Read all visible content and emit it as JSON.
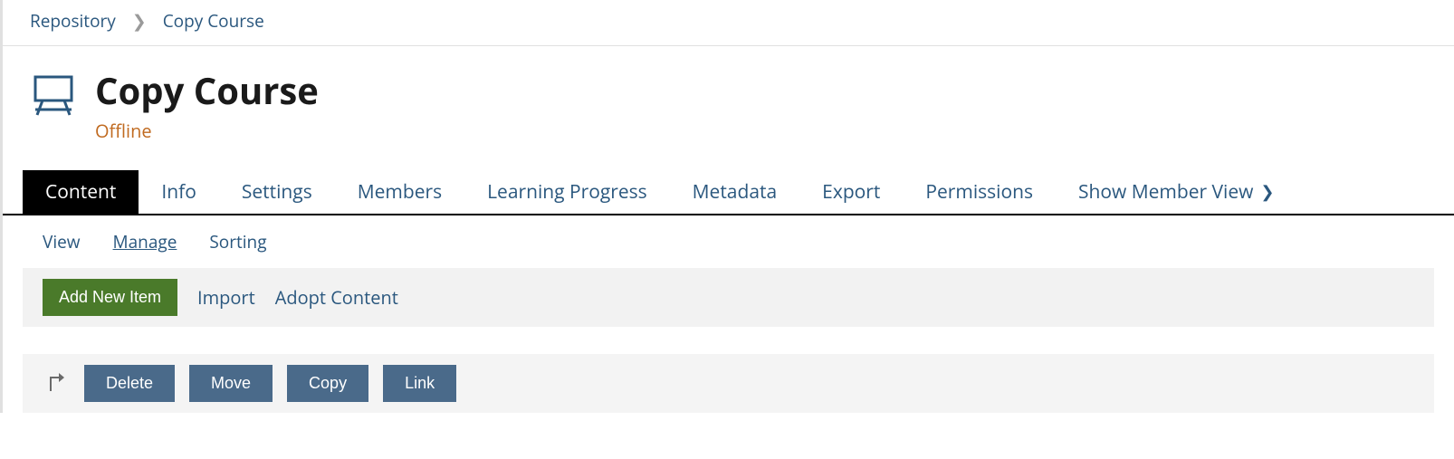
{
  "breadcrumb": {
    "root": "Repository",
    "current": "Copy Course"
  },
  "header": {
    "title": "Copy Course",
    "status": "Offline"
  },
  "tabs": [
    {
      "label": "Content",
      "active": true
    },
    {
      "label": "Info"
    },
    {
      "label": "Settings"
    },
    {
      "label": "Members"
    },
    {
      "label": "Learning Progress"
    },
    {
      "label": "Metadata"
    },
    {
      "label": "Export"
    },
    {
      "label": "Permissions"
    },
    {
      "label": "Show Member View",
      "hasArrow": true
    }
  ],
  "subtabs": [
    {
      "label": "View"
    },
    {
      "label": "Manage",
      "active": true
    },
    {
      "label": "Sorting"
    }
  ],
  "toolbar": {
    "primary": "Add New Item",
    "links": [
      "Import",
      "Adopt Content"
    ]
  },
  "actions": {
    "buttons": [
      "Delete",
      "Move",
      "Copy",
      "Link"
    ]
  }
}
